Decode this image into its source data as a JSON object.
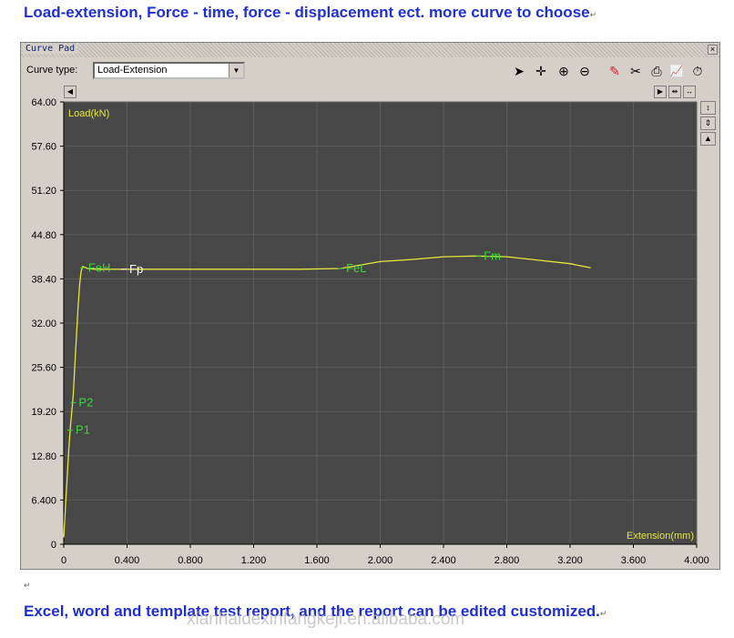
{
  "headline": "Load-extension, Force - time, force - displacement ect. more curve to choose",
  "footline": "Excel, word and template test report, and the report can be edited customized.",
  "watermark": "xianhaidexinfangkeji.en.alibaba.com",
  "return_mark": "↵",
  "window": {
    "title": "Curve Pad",
    "close_label": "×",
    "curve_type_label": "Curve type:",
    "curve_type_value": "Load-Extension",
    "dropdown_arrow": "▼"
  },
  "toolbar": [
    {
      "name": "pointer-icon",
      "glyph": "➤"
    },
    {
      "name": "crosshair-icon",
      "glyph": "✛"
    },
    {
      "name": "zoom-in-icon",
      "glyph": "⊕"
    },
    {
      "name": "zoom-out-icon",
      "glyph": "⊖"
    },
    {
      "name": "pen-icon",
      "glyph": "✎"
    },
    {
      "name": "scissors-icon",
      "glyph": "✂"
    },
    {
      "name": "printer-icon",
      "glyph": "⎙"
    },
    {
      "name": "chart-icon",
      "glyph": "📈"
    },
    {
      "name": "clock-icon",
      "glyph": "⏱"
    }
  ],
  "scroll": {
    "left": "◀",
    "right": "▶",
    "fit_h": "⇹",
    "fit_w": "↔",
    "fit_v": "↕",
    "fit_vb": "⇕",
    "up": "▲"
  },
  "chart_data": {
    "type": "line",
    "xlabel": "Extension(mm)",
    "ylabel": "Load(kN)",
    "xlim": [
      0,
      4.0
    ],
    "ylim": [
      0,
      64.0
    ],
    "x_ticks": [
      "0",
      "0.400",
      "0.800",
      "1.200",
      "1.600",
      "2.000",
      "2.400",
      "2.800",
      "3.200",
      "3.600",
      "4.000"
    ],
    "y_ticks": [
      "0",
      "6.400",
      "12.80",
      "19.20",
      "25.60",
      "32.00",
      "38.40",
      "44.80",
      "51.20",
      "57.60",
      "64.00"
    ],
    "grid": true,
    "line_color": "#e6e640",
    "background": "#474747",
    "series": [
      {
        "x": [
          0.0,
          0.01,
          0.02,
          0.03,
          0.04,
          0.05,
          0.06,
          0.07,
          0.08,
          0.09,
          0.1,
          0.11,
          0.12,
          0.15,
          0.2,
          0.5,
          1.0,
          1.5,
          1.75,
          1.85,
          2.0,
          2.2,
          2.4,
          2.6,
          2.8,
          3.0,
          3.2,
          3.33
        ],
        "y": [
          1.0,
          5.0,
          9.0,
          13.0,
          16.5,
          19.0,
          21.5,
          26.0,
          30.0,
          34.0,
          37.5,
          39.5,
          40.2,
          39.9,
          39.8,
          39.8,
          39.8,
          39.8,
          39.9,
          40.3,
          40.9,
          41.2,
          41.6,
          41.7,
          41.6,
          41.1,
          40.6,
          40.0
        ]
      }
    ],
    "annotations": [
      {
        "label": "FeH",
        "x": 0.12,
        "y": 40.0,
        "color": "#38d838"
      },
      {
        "label": "Fp",
        "x": 0.38,
        "y": 39.8,
        "color": "#ffffff"
      },
      {
        "label": "FeL",
        "x": 1.75,
        "y": 39.9,
        "color": "#38d838"
      },
      {
        "label": "Fm",
        "x": 2.62,
        "y": 41.7,
        "color": "#38d838"
      },
      {
        "label": "P2",
        "x": 0.06,
        "y": 20.5,
        "color": "#38d838"
      },
      {
        "label": "P1",
        "x": 0.04,
        "y": 16.5,
        "color": "#38d838"
      }
    ]
  }
}
